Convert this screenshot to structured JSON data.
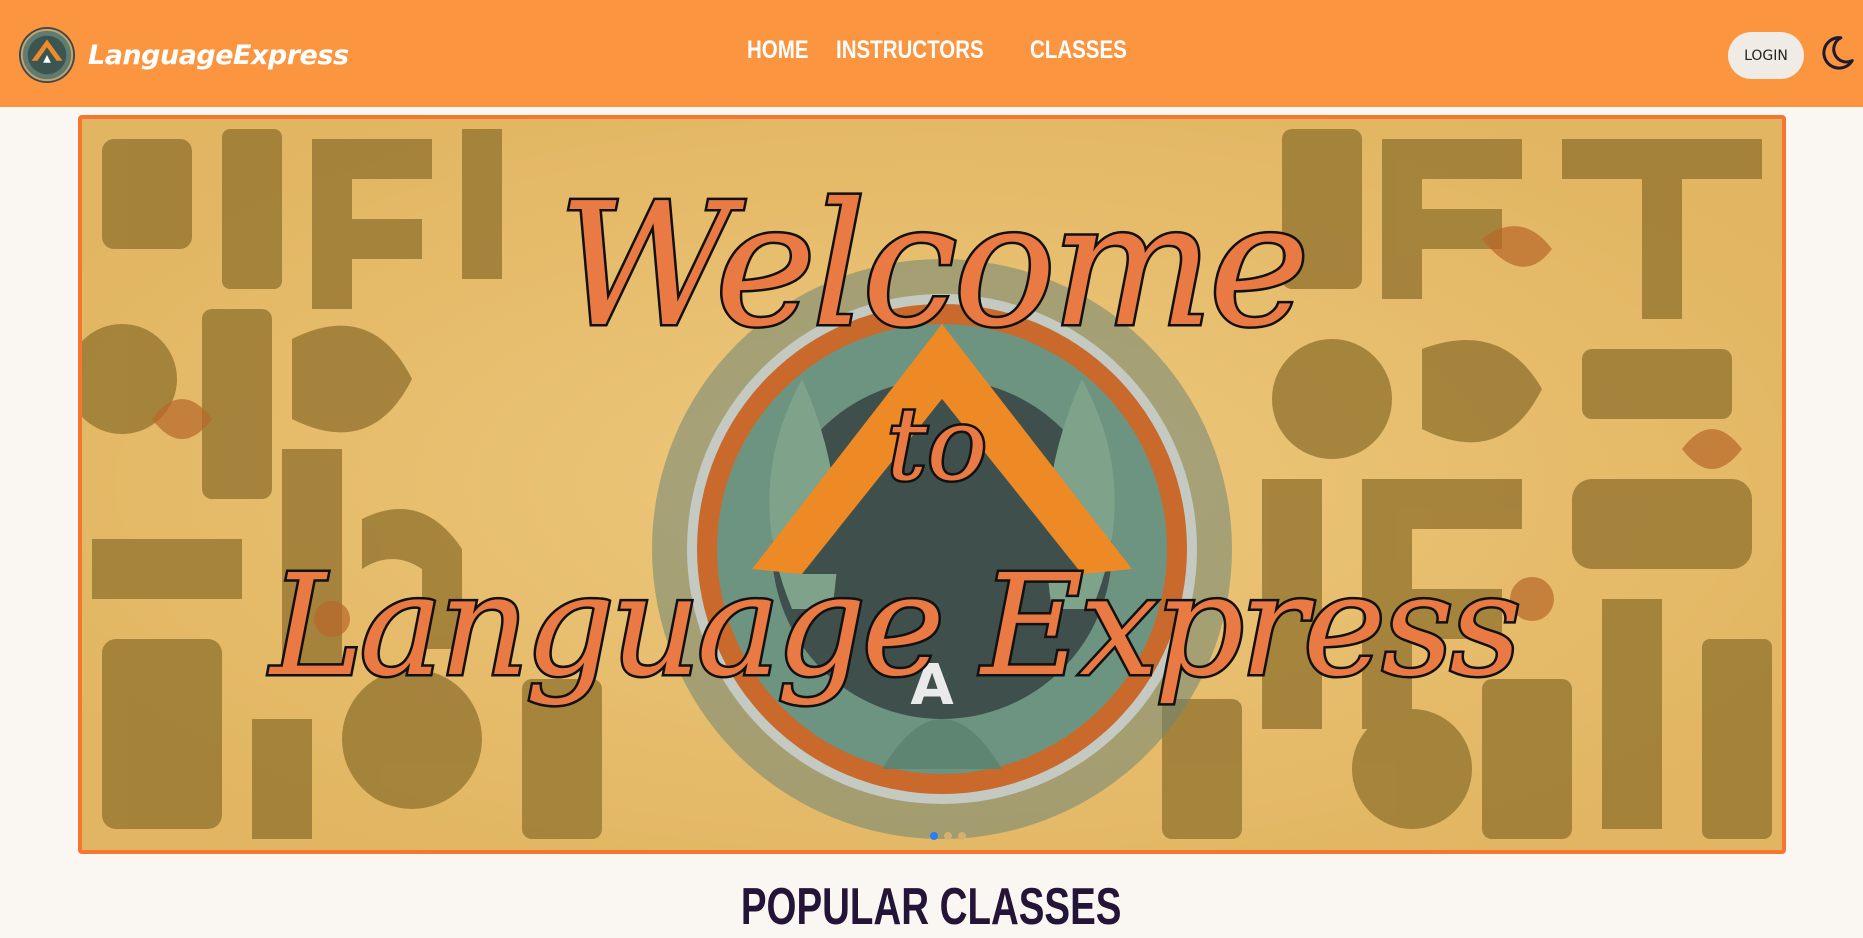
{
  "brand": {
    "name": "LanguageExpress",
    "logo_icon": "language-express-logo-icon"
  },
  "nav": {
    "links": [
      "HOME",
      "INSTRUCTORS",
      "CLASSES"
    ]
  },
  "header": {
    "login_label": "LOGIN",
    "theme_icon": "moon-icon"
  },
  "banner": {
    "line1": "Welcome",
    "line2": "to",
    "line3": "Language Express",
    "badge_letter": "A",
    "slide_count": 3,
    "active_slide": 1
  },
  "sections": {
    "popular_title": "POPULAR CLASSES"
  },
  "colors": {
    "nav_bg": "#fb953f",
    "accent": "#f4762f",
    "page_bg": "#faf6f2",
    "heading": "#241437",
    "dot_active": "#2a7ff0"
  }
}
